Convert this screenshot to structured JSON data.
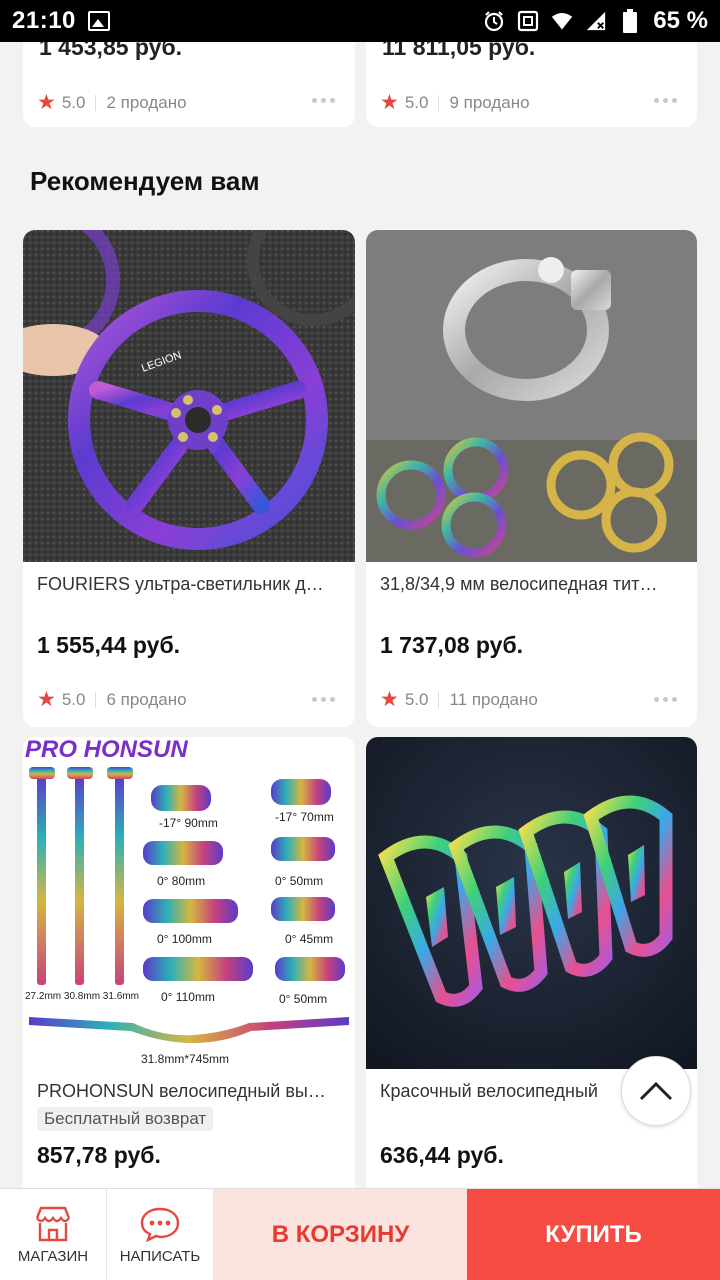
{
  "status_bar": {
    "time": "21:10",
    "battery_pct": "65 %"
  },
  "top_row": [
    {
      "price": "1 453,85 руб.",
      "rating": "5.0",
      "sold": "2 продано"
    },
    {
      "price": "11 811,05 руб.",
      "rating": "5.0",
      "sold": "9 продано"
    }
  ],
  "section": {
    "title": "Рекомендуем вам"
  },
  "products": [
    {
      "title": "FOURIERS ультра-светильник д…",
      "price": "1 555,44 руб.",
      "rating": "5.0",
      "sold": "6 продано",
      "image_label": "LEGION"
    },
    {
      "title": "31,8/34,9 мм велосипедная тит…",
      "price": "1 737,08 руб.",
      "rating": "5.0",
      "sold": "11 продано"
    },
    {
      "title": "PROHONSUN велосипедный вы…",
      "badge": "Бесплатный возврат",
      "price": "857,78 руб.",
      "image_label": "PRO HONSUN",
      "image_specs": [
        "-17° 90mm",
        "-17° 70mm",
        "0° 80mm",
        "0° 50mm",
        "0° 100mm",
        "0° 45mm",
        "0° 110mm",
        "0° 50mm",
        "27.2mm 30.8mm 31.6mm",
        "31.8mm*745mm"
      ]
    },
    {
      "title": "Красочный велосипедный",
      "price": "636,44 руб."
    }
  ],
  "bottom_bar": {
    "shop_label": "МАГАЗИН",
    "message_label": "НАПИСАТЬ",
    "cart_label": "В КОРЗИНУ",
    "buy_label": "КУПИТЬ"
  },
  "colors": {
    "accent": "#f64c43",
    "cart_bg": "#fde3e0",
    "star": "#e5483f"
  }
}
